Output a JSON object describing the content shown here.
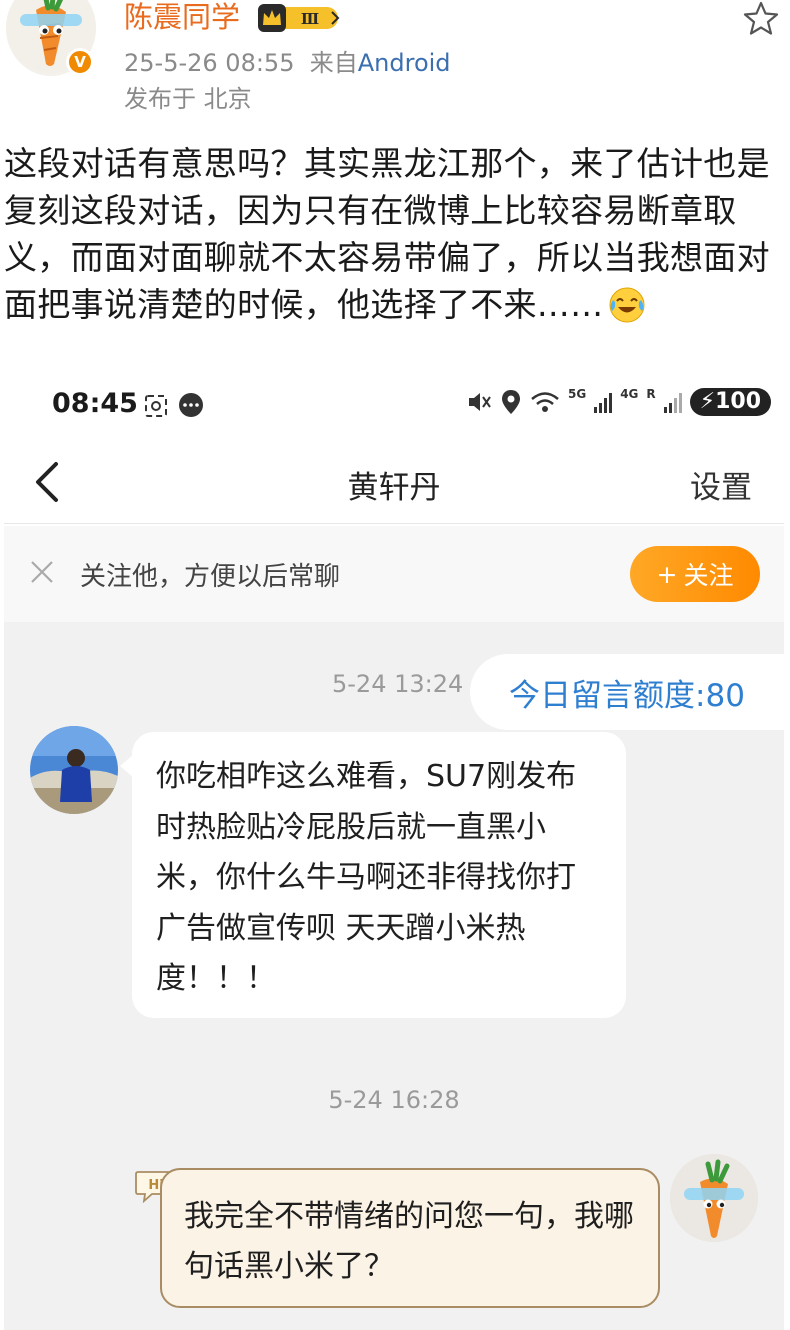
{
  "post": {
    "username": "陈震同学",
    "rank_badge": "Ⅲ",
    "date": "25-5-26 08:55",
    "source_prefix": "来自",
    "source_app": "Android",
    "location": "发布于 北京",
    "text": "这段对话有意思吗？其实黑龙江那个，来了估计也是复刻这段对话，因为只有在微博上比较容易断章取义，而面对面聊就不太容易带偏了，所以当我想面对面把事说清楚的时候，他选择了不来……",
    "emoji": "laugh-cry-emoji",
    "verify_mark": "V"
  },
  "screenshot": {
    "status_bar": {
      "time": "08:45",
      "net_5g": "5G",
      "net_4g": "4G",
      "roaming": "R",
      "battery": "100"
    },
    "nav": {
      "back_icon": "chevron-left-icon",
      "title": "黄轩丹",
      "settings_label": "设置"
    },
    "follow_bar": {
      "text": "关注他，方便以后常聊",
      "button_label": "关注",
      "button_plus": "+"
    },
    "chat": {
      "quota": "今日留言额度:80",
      "messages": [
        {
          "time": "5-24 13:24",
          "side": "left",
          "text": "你吃相咋这么难看，SU7刚发布时热脸贴冷屁股后就一直黑小米，你什么牛马啊还非得找你打广告做宣传呗 天天蹭小米热度！！！"
        },
        {
          "time": "5-24 16:28",
          "side": "right",
          "badge": "Hi",
          "text": "我完全不带情绪的问您一句，我哪句话黑小米了？"
        }
      ]
    }
  },
  "colors": {
    "username": "#e86b1e",
    "link": "#3b6fb0",
    "follow_button": "#ff9a12",
    "quota_text": "#2f7fd1",
    "chat_bg": "#f1f1f1"
  }
}
